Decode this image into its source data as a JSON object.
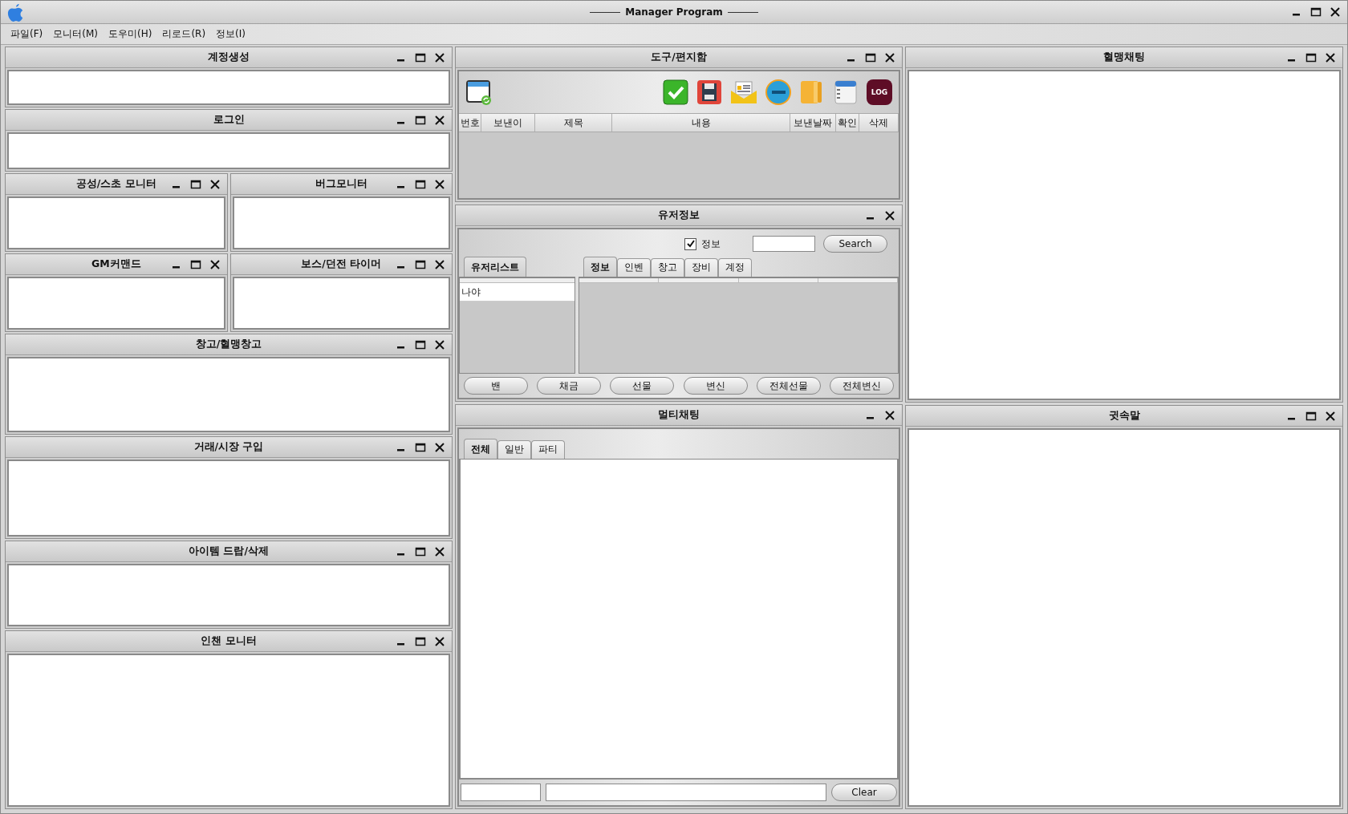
{
  "window": {
    "title": "Manager Program"
  },
  "menu": [
    {
      "label": "파일(F)"
    },
    {
      "label": "모니터(M)"
    },
    {
      "label": "도우미(H)"
    },
    {
      "label": "리로드(R)"
    },
    {
      "label": "정보(I)"
    }
  ],
  "left_panels": [
    [
      {
        "title": "계정생성",
        "maximizable": true
      }
    ],
    [
      {
        "title": "로그인",
        "maximizable": true
      }
    ],
    [
      {
        "title": "공성/스초 모니터",
        "maximizable": true
      },
      {
        "title": "버그모니터",
        "maximizable": true
      }
    ],
    [
      {
        "title": "GM커맨드",
        "maximizable": true
      },
      {
        "title": "보스/던전 타이머",
        "maximizable": true
      }
    ],
    [
      {
        "title": "창고/혈맹창고",
        "maximizable": true
      }
    ],
    [
      {
        "title": "거래/시장 구입",
        "maximizable": true
      }
    ],
    [
      {
        "title": "아이템 드랍/삭제",
        "maximizable": true
      }
    ],
    [
      {
        "title": "인챈 모니터",
        "maximizable": true
      }
    ]
  ],
  "mailbox": {
    "title": "도구/편지함",
    "maximizable": true,
    "log_badge": "LOG",
    "columns": [
      "번호",
      "보낸이",
      "제목",
      "내용",
      "보낸날짜",
      "확인",
      "삭제"
    ]
  },
  "user_info": {
    "title": "유저정보",
    "maximizable": false,
    "filter": {
      "label": "정보",
      "checked": true
    },
    "search_button": "Search",
    "list_tab": {
      "label": "유저리스트",
      "selected": true
    },
    "users": [
      {
        "name": "나야",
        "selected": false
      }
    ],
    "tabs": [
      {
        "label": "정보",
        "selected": true
      },
      {
        "label": "인벤",
        "selected": false
      },
      {
        "label": "창고",
        "selected": false
      },
      {
        "label": "장비",
        "selected": false
      },
      {
        "label": "계정",
        "selected": false
      }
    ],
    "actions": [
      "밴",
      "채금",
      "선물",
      "변신",
      "전체선물",
      "전체변신"
    ]
  },
  "multi_chat": {
    "title": "멀티채팅",
    "maximizable": false,
    "tabs": [
      {
        "label": "전체",
        "selected": true
      },
      {
        "label": "일반",
        "selected": false
      },
      {
        "label": "파티",
        "selected": false
      }
    ],
    "clear_button": "Clear"
  },
  "guild_chat": {
    "title": "혈맹채팅",
    "maximizable": true
  },
  "whisper": {
    "title": "귓속말",
    "maximizable": true
  }
}
